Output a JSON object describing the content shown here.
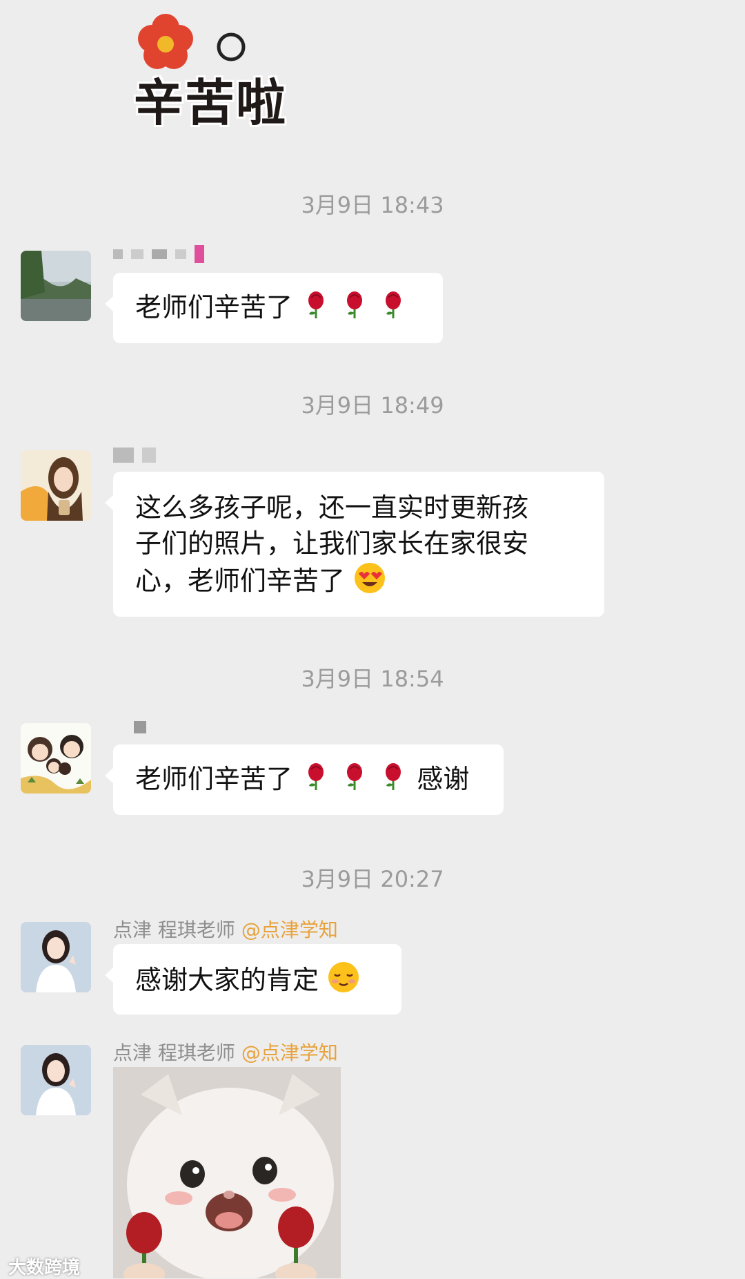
{
  "sticker": {
    "text": "辛苦啦"
  },
  "messages": [
    {
      "time": "3月9日 18:43",
      "text": "老师们辛苦了",
      "emojis": [
        "rose-icon",
        "rose-icon",
        "rose-icon"
      ]
    },
    {
      "time": "3月9日 18:49",
      "line1": "这么多孩子呢，还一直实时更新孩",
      "line2": "子们的照片，让我们家长在家很安",
      "line3": "心，老师们辛苦了",
      "emojis": [
        "heart-eyes-icon"
      ]
    },
    {
      "time": "3月9日 18:54",
      "text": "老师们辛苦了",
      "suffix": "感谢",
      "emojis": [
        "rose-icon",
        "rose-icon",
        "rose-icon"
      ]
    },
    {
      "time": "3月9日 20:27",
      "sender": "点津 程琪老师",
      "sender_tag": "@点津学知",
      "text": "感谢大家的肯定",
      "emojis": [
        "blush-icon"
      ]
    },
    {
      "sender": "点津 程琪老师",
      "sender_tag": "@点津学知",
      "image": "cat-with-roses-sticker"
    }
  ],
  "watermark": "大数跨境",
  "colors": {
    "background": "#ededed",
    "bubble": "#ffffff",
    "timestamp": "#9b9b9b",
    "sender_tag": "#e8a23c"
  }
}
